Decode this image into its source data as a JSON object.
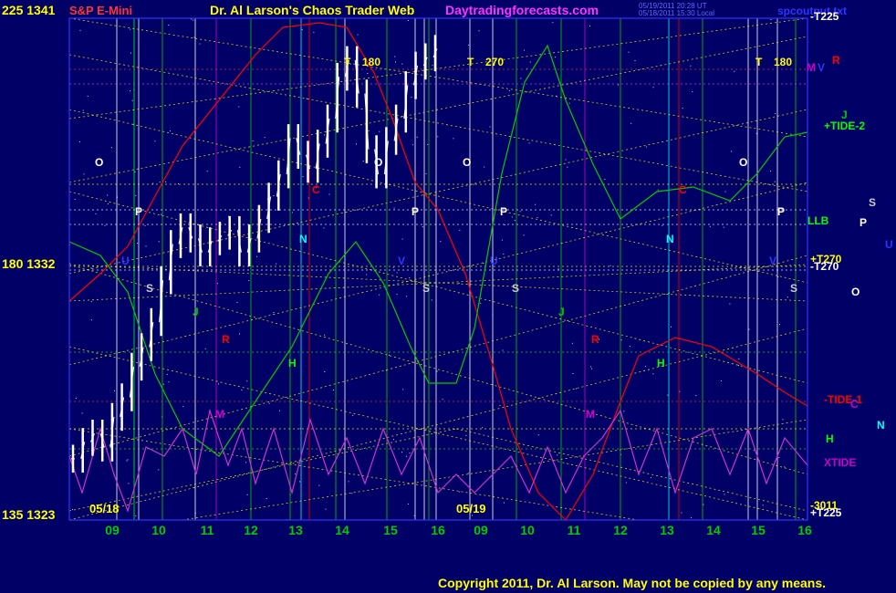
{
  "header": {
    "left_price_label": "225  1341",
    "symbol": "S&P E-Mini",
    "title": "Dr. Al Larson's Chaos Trader Web",
    "site": "Daytradingforecasts.com",
    "stamp_line1": "05/19/2011 20:28 UT",
    "stamp_line2": "05/18/2011 15:30 Local",
    "right_title": "spcoutput.txt"
  },
  "left_axis": {
    "mid_label": "180  1332",
    "bottom_label": "135  1323"
  },
  "date_labels": [
    "05/18",
    "05/19"
  ],
  "hour_labels": [
    "09",
    "10",
    "11",
    "12",
    "13",
    "14",
    "15",
    "16",
    "09",
    "10",
    "11",
    "12",
    "13",
    "14",
    "15",
    "16"
  ],
  "copyright": "Copyright 2011, Dr. Al Larson. May not be copied by any means.",
  "right_labels": [
    {
      "text": "-T225",
      "color": "#ffffff"
    },
    {
      "text": "M",
      "color": "#cc00cc"
    },
    {
      "text": "V",
      "color": "#3333ff"
    },
    {
      "text": "R",
      "color": "#ff0000"
    },
    {
      "text": "J",
      "color": "#00cc00"
    },
    {
      "text": "+TIDE-2",
      "color": "#00ff00"
    },
    {
      "text": "S",
      "color": "#cccccc"
    },
    {
      "text": "LLB",
      "color": "#00ff00"
    },
    {
      "text": "P",
      "color": "#ffffff"
    },
    {
      "text": "U",
      "color": "#3333ff"
    },
    {
      "text": "+T270",
      "color": "#ffff00"
    },
    {
      "text": "-T270",
      "color": "#ffffff"
    },
    {
      "text": "O",
      "color": "#ffffff"
    },
    {
      "text": "-TIDE-1",
      "color": "#ff0000"
    },
    {
      "text": "C",
      "color": "#cc00cc"
    },
    {
      "text": "N",
      "color": "#00ffff"
    },
    {
      "text": "H",
      "color": "#00ff00"
    },
    {
      "text": "XTIDE",
      "color": "#cc00cc"
    },
    {
      "text": "-3011",
      "color": "#ffff00"
    },
    {
      "text": "+T225",
      "color": "#ffffff"
    }
  ],
  "flux_markers": [
    {
      "text": "T",
      "color": "#ffff00"
    },
    {
      "text": "180",
      "color": "#ffff00"
    },
    {
      "text": "T",
      "color": "#ffff00"
    },
    {
      "text": "270",
      "color": "#ffff00"
    },
    {
      "text": "T",
      "color": "#ffff00"
    },
    {
      "text": "180",
      "color": "#ffff00"
    },
    {
      "text": "O",
      "color": "#ffffff"
    },
    {
      "text": "O",
      "color": "#ffffff"
    },
    {
      "text": "O",
      "color": "#ffffff"
    },
    {
      "text": "O",
      "color": "#ffffff"
    },
    {
      "text": "P",
      "color": "#ffffff"
    },
    {
      "text": "P",
      "color": "#ffffff"
    },
    {
      "text": "P",
      "color": "#ffffff"
    },
    {
      "text": "P",
      "color": "#ffffff"
    },
    {
      "text": "S",
      "color": "#cccccc"
    },
    {
      "text": "S",
      "color": "#cccccc"
    },
    {
      "text": "S",
      "color": "#cccccc"
    },
    {
      "text": "S",
      "color": "#cccccc"
    },
    {
      "text": "C",
      "color": "#ff0000"
    },
    {
      "text": "C",
      "color": "#ff0000"
    },
    {
      "text": "N",
      "color": "#00ffff"
    },
    {
      "text": "N",
      "color": "#00ffff"
    },
    {
      "text": "J",
      "color": "#00cc00"
    },
    {
      "text": "J",
      "color": "#00cc00"
    },
    {
      "text": "R",
      "color": "#ff0000"
    },
    {
      "text": "R",
      "color": "#ff0000"
    },
    {
      "text": "H",
      "color": "#00ff00"
    },
    {
      "text": "H",
      "color": "#00ff00"
    },
    {
      "text": "M",
      "color": "#cc00cc"
    },
    {
      "text": "M",
      "color": "#cc00cc"
    },
    {
      "text": "U",
      "color": "#3333ff"
    },
    {
      "text": "U",
      "color": "#3333ff"
    },
    {
      "text": "V",
      "color": "#3333ff"
    },
    {
      "text": "V",
      "color": "#3333ff"
    }
  ],
  "colors": {
    "background": "#000066",
    "price_bars": "#ffffff",
    "grid_yellow": "#ffff00",
    "axis_frame": "#3333ff",
    "tide_red": "#ff0000",
    "tide_green": "#00cc00",
    "xtide": "#cc33cc"
  },
  "chart_data": {
    "type": "line",
    "title": "S&P E-Mini",
    "y_range": [
      1323,
      1341
    ],
    "y_ticks": [
      1323,
      1332,
      1341
    ],
    "y_angle_ticks": [
      135,
      180,
      225
    ],
    "x_labels": [
      "09",
      "10",
      "11",
      "12",
      "13",
      "14",
      "15",
      "16",
      "09",
      "10",
      "11",
      "12",
      "13",
      "14",
      "15",
      "16"
    ],
    "dates": [
      "05/18",
      "05/19"
    ],
    "price_close_series": [
      1325.2,
      1325.8,
      1326.1,
      1325.6,
      1326.7,
      1327.4,
      1328.5,
      1329.2,
      1330.1,
      1331.6,
      1332.9,
      1333.5,
      1333.1,
      1332.6,
      1333.0,
      1333.2,
      1333.4,
      1332.6,
      1333.1,
      1333.8,
      1334.6,
      1335.4,
      1336.7,
      1336.1,
      1335.6,
      1336.5,
      1337.4,
      1338.9,
      1339.5,
      1338.3,
      1336.3,
      1335.4,
      1336.6,
      1337.4,
      1338.6,
      1339.3,
      1339.6,
      1339.9
    ]
  }
}
